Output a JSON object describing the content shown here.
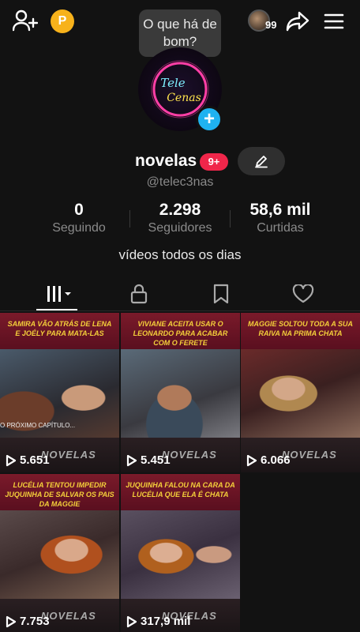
{
  "topbar": {
    "coin_label": "P",
    "notification_count": "99"
  },
  "tooltip": {
    "text": "O que há de bom?"
  },
  "profile": {
    "username": "novelas",
    "badge": "9+",
    "handle": "@telec3nas",
    "bio": "vídeos todos os dias",
    "avatar_text_line1": "Tele",
    "avatar_text_line2": "Cenas"
  },
  "stats": [
    {
      "value": "0",
      "label": "Seguindo"
    },
    {
      "value": "2.298",
      "label": "Seguidores"
    },
    {
      "value": "58,6 mil",
      "label": "Curtidas"
    }
  ],
  "tabs": [
    {
      "icon": "videos-grid-icon",
      "active": true
    },
    {
      "icon": "lock-icon",
      "active": false
    },
    {
      "icon": "bookmark-icon",
      "active": false
    },
    {
      "icon": "heart-icon",
      "active": false
    }
  ],
  "videos": [
    {
      "caption": "Samira vão atrás de Lena e Joély para mata-las",
      "views": "5.651",
      "brand": "NOVELAS",
      "overlay": "O PRÓXIMO CAPÍTULO..."
    },
    {
      "caption": "Viviane aceita usar o Leonardo para acabar com o Ferete",
      "views": "5.451",
      "brand": "NOVELAS",
      "overlay": ""
    },
    {
      "caption": "Maggie soltou toda a sua raiva na prima chata",
      "views": "6.066",
      "brand": "NOVELAS",
      "overlay": ""
    },
    {
      "caption": "Lucélia tentou impedir Juquinha de salvar os pais da Maggie",
      "views": "7.753",
      "brand": "NOVELAS",
      "overlay": ""
    },
    {
      "caption": "Juquinha falou na cara da Lucélia que ela é chata",
      "views": "317,9 mil",
      "brand": "NOVELAS",
      "overlay": ""
    }
  ]
}
